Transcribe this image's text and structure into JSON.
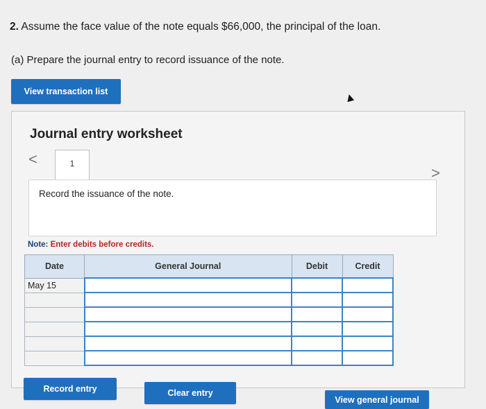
{
  "question": {
    "number": "2.",
    "text": "Assume the face value of the note equals $66,000, the principal of the loan.",
    "part": "(a) Prepare the journal entry to record issuance of the note."
  },
  "buttons": {
    "view_transaction_list": "View transaction list",
    "record_entry": "Record entry",
    "clear_entry": "Clear entry",
    "view_general_journal": "View general journal"
  },
  "worksheet": {
    "title": "Journal entry worksheet",
    "tab_label": "1",
    "prev_icon": "<",
    "next_icon": ">",
    "instruction": "Record the issuance of the note.",
    "note_label": "Note:",
    "note_text": " Enter debits before credits."
  },
  "journal": {
    "headers": [
      "Date",
      "General Journal",
      "Debit",
      "Credit"
    ],
    "rows": [
      {
        "date": "May 15",
        "account": "",
        "debit": "",
        "credit": ""
      },
      {
        "date": "",
        "account": "",
        "debit": "",
        "credit": ""
      },
      {
        "date": "",
        "account": "",
        "debit": "",
        "credit": ""
      },
      {
        "date": "",
        "account": "",
        "debit": "",
        "credit": ""
      },
      {
        "date": "",
        "account": "",
        "debit": "",
        "credit": ""
      },
      {
        "date": "",
        "account": "",
        "debit": "",
        "credit": ""
      }
    ]
  },
  "colors": {
    "button_blue": "#1f6fbf",
    "header_fill": "#d9e4f2",
    "note_red": "#b3261e",
    "input_border": "#3b83c9"
  }
}
